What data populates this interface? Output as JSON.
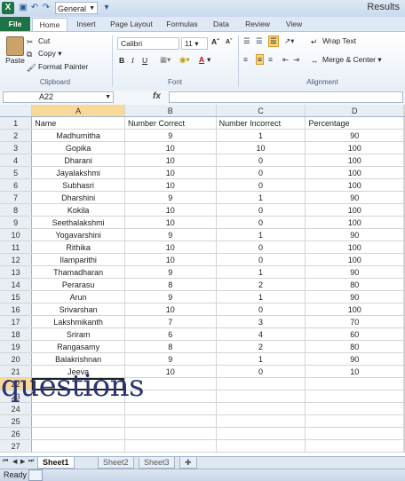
{
  "titlebar": {
    "title": "Results",
    "number_format": "General",
    "icons": [
      "excel-logo-icon",
      "save-icon",
      "undo-icon",
      "redo-icon",
      "customize-icon"
    ]
  },
  "ribbon": {
    "tabs": [
      "File",
      "Home",
      "Insert",
      "Page Layout",
      "Formulas",
      "Data",
      "Review",
      "View"
    ],
    "clipboard": {
      "paste": "Paste",
      "cut": "Cut",
      "copy": "Copy",
      "format_painter": "Format Painter",
      "label": "Clipboard"
    },
    "font": {
      "name": "Calibri",
      "size": "11",
      "label": "Font",
      "bold": "B",
      "italic": "I",
      "underline": "U"
    },
    "alignment": {
      "wrap_text": "Wrap Text",
      "merge_center": "Merge & Center",
      "label": "Alignment"
    }
  },
  "formula_bar": {
    "name_box": "A22",
    "fx": "fx",
    "value": ""
  },
  "sheet": {
    "columns": [
      "A",
      "B",
      "C",
      "D"
    ],
    "active_cell": "A22",
    "rows": [
      [
        "Name",
        "Number Correct",
        "Number Incorrect",
        "Percentage"
      ],
      [
        "Madhumitha",
        "9",
        "1",
        "90"
      ],
      [
        "Gopika",
        "10",
        "10",
        "100"
      ],
      [
        "Dharani",
        "10",
        "0",
        "100"
      ],
      [
        "Jayalakshmi",
        "10",
        "0",
        "100"
      ],
      [
        "Subhasri",
        "10",
        "0",
        "100"
      ],
      [
        "Dharshini",
        "9",
        "1",
        "90"
      ],
      [
        "Kokila",
        "10",
        "0",
        "100"
      ],
      [
        "Seethalakshmi",
        "10",
        "0",
        "100"
      ],
      [
        "Yogavarshini",
        "9",
        "1",
        "90"
      ],
      [
        "Rithika",
        "10",
        "0",
        "100"
      ],
      [
        "Ilamparithi",
        "10",
        "0",
        "100"
      ],
      [
        "Thamadharan",
        "9",
        "1",
        "90"
      ],
      [
        "Perarasu",
        "8",
        "2",
        "80"
      ],
      [
        "Arun",
        "9",
        "1",
        "90"
      ],
      [
        "Srivarshan",
        "10",
        "0",
        "100"
      ],
      [
        "Lakshmikanth",
        "7",
        "3",
        "70"
      ],
      [
        "Sriram",
        "6",
        "4",
        "60"
      ],
      [
        "Rangasamy",
        "8",
        "2",
        "80"
      ],
      [
        "Balakrishnan",
        "9",
        "1",
        "90"
      ],
      [
        "Jeeva",
        "10",
        "0",
        "10"
      ],
      [
        "",
        "",
        "",
        ""
      ],
      [
        "",
        "",
        "",
        ""
      ],
      [
        "",
        "",
        "",
        ""
      ],
      [
        "",
        "",
        "",
        ""
      ],
      [
        "",
        "",
        "",
        ""
      ],
      [
        "",
        "",
        "",
        ""
      ]
    ]
  },
  "overlay_text": "questions",
  "sheet_tabs": [
    "Sheet1",
    "Sheet2",
    "Sheet3"
  ],
  "status": "Ready",
  "colors": {
    "file_tab": "#1f7244",
    "overlay_text": "#2d3475",
    "selected_header": "#f9d99a"
  }
}
